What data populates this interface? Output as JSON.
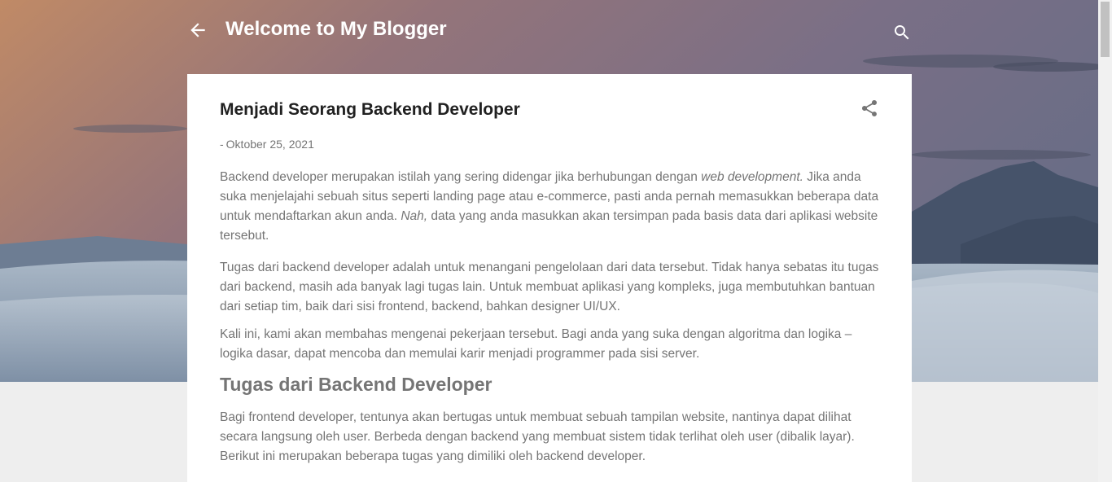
{
  "header": {
    "blog_title": "Welcome to My Blogger",
    "back_icon": "arrow-left-icon",
    "search_icon": "search-icon"
  },
  "post": {
    "title": "Menjadi Seorang Backend Developer",
    "date_prefix": "-",
    "date": "Oktober 25, 2021",
    "share_icon": "share-icon",
    "paragraphs": {
      "p1": {
        "a": " Backend developer merupakan istilah yang sering didengar jika berhubungan dengan ",
        "b": "web development.",
        "c": " Jika anda suka menjelajahi sebuah situs seperti landing page atau e-commerce, pasti anda pernah memasukkan beberapa data untuk mendaftarkan akun anda. ",
        "d": "Nah,",
        "e": " data yang anda masukkan akan tersimpan pada basis data dari aplikasi website tersebut."
      },
      "p2": "Tugas dari backend developer adalah untuk menangani pengelolaan dari data tersebut. Tidak hanya sebatas itu tugas dari backend, masih ada banyak lagi tugas lain. Untuk membuat aplikasi yang kompleks, juga membutuhkan bantuan dari setiap tim, baik dari sisi frontend, backend, bahkan designer UI/UX.",
      "p3": "Kali ini, kami akan membahas mengenai pekerjaan tersebut. Bagi anda yang suka dengan algoritma dan logika – logika dasar, dapat mencoba dan memulai karir menjadi programmer pada sisi server.",
      "h1": "Tugas dari Backend Developer",
      "p4": "Bagi frontend developer, tentunya akan bertugas untuk membuat sebuah tampilan website, nantinya dapat dilihat secara langsung oleh user. Berbeda dengan backend yang membuat sistem tidak terlihat oleh user (dibalik layar). Berikut ini merupakan beberapa tugas yang dimiliki oleh backend developer."
    }
  },
  "colors": {
    "card_bg": "#ffffff",
    "page_bg": "#eeeeee",
    "title_text": "#212121",
    "body_text": "#757575"
  }
}
